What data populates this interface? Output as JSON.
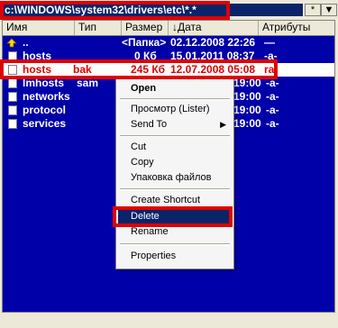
{
  "path": {
    "value": "c:\\WINDOWS\\system32\\drivers\\etc\\*.*",
    "star_label": "*",
    "dropdown_label": "▼"
  },
  "columns": {
    "name": "Имя",
    "ext": "Тип",
    "size": "Размер",
    "date": "↓Дата",
    "attr": "Атрибуты"
  },
  "files": [
    {
      "name": "..",
      "ext": "",
      "size": "<Папка>",
      "date": "02.12.2008 22:26",
      "attr": "—",
      "icon": "up-folder-icon"
    },
    {
      "name": "hosts",
      "ext": "",
      "size": "0 Кб",
      "date": "15.01.2011 08:37",
      "attr": "-a-",
      "icon": "file-icon"
    },
    {
      "name": "hosts",
      "ext": "bak",
      "size": "245 Кб",
      "date": "12.07.2008 05:08",
      "attr": "ra-",
      "icon": "file-icon"
    },
    {
      "name": "lmhosts",
      "ext": "sam",
      "size": "",
      "date": "19:00",
      "attr": "-a-",
      "icon": "file-icon"
    },
    {
      "name": "networks",
      "ext": "",
      "size": "",
      "date": "19:00",
      "attr": "-a-",
      "icon": "file-icon"
    },
    {
      "name": "protocol",
      "ext": "",
      "size": "",
      "date": "19:00",
      "attr": "-a-",
      "icon": "file-icon"
    },
    {
      "name": "services",
      "ext": "",
      "size": "",
      "date": "19:00",
      "attr": "-a-",
      "icon": "file-icon"
    }
  ],
  "context_menu": {
    "open": "Open",
    "view": "Просмотр (Lister)",
    "send_to": "Send To",
    "cut": "Cut",
    "copy": "Copy",
    "pack": "Упаковка файлов",
    "create_shortcut": "Create Shortcut",
    "delete": "Delete",
    "rename": "Rename",
    "properties": "Properties"
  },
  "colors": {
    "panel_bg": "#0000a8",
    "highlight": "#0a246a",
    "annotation_red": "#e00000"
  }
}
